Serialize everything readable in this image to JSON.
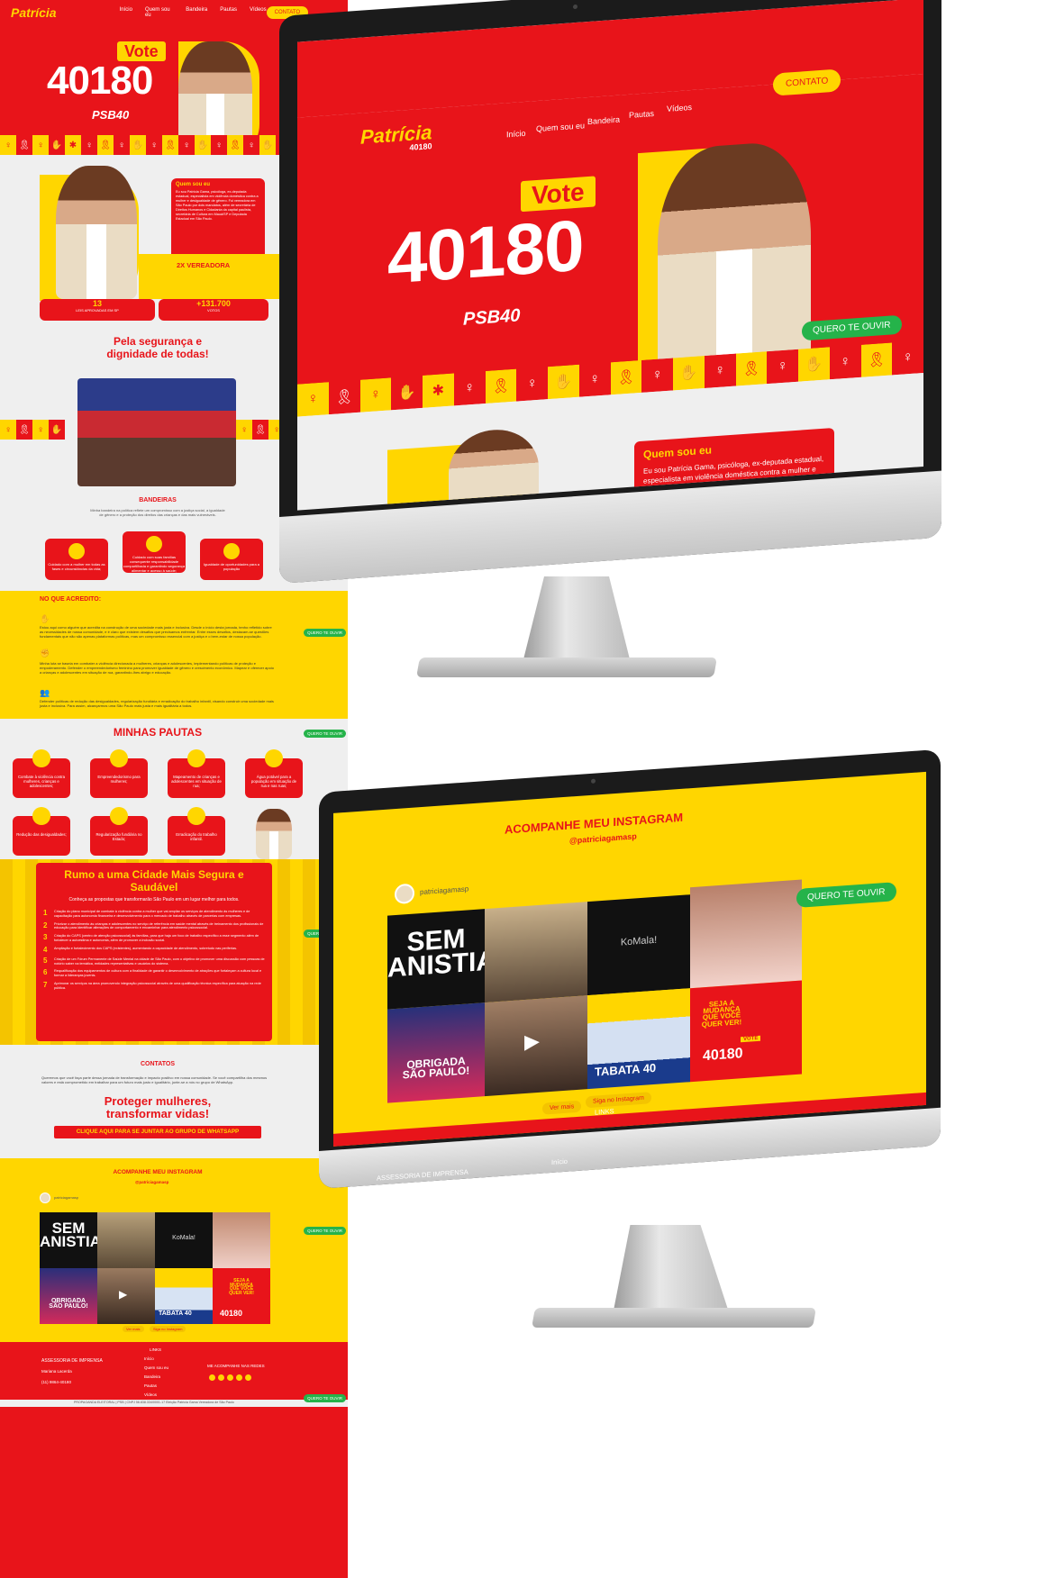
{
  "brand": {
    "first_name": "Patrícia",
    "last_name": "Gama",
    "number": "40180",
    "tag": "Vereadora",
    "party": "PSB40"
  },
  "nav": {
    "items": [
      "Início",
      "Quem sou eu",
      "Bandeira",
      "Pautas",
      "Vídeos"
    ],
    "contact": "CONTATO"
  },
  "hero": {
    "vote": "Vote",
    "number": "40180",
    "party": "PSB40",
    "whatsapp": "QUERO TE OUVIR"
  },
  "about": {
    "title": "Quem sou eu",
    "text": "Eu sou Patrícia Gama, psicóloga, ex-deputada estadual, especialista em violência doméstica contra a mulher e desigualdade de gênero. Fui vereadora em São Paulo por dois mandatos, além de secretária de",
    "short_text": "Eu sou Patrícia Gama, psicóloga, ex-deputada estadual, especialista em violência doméstica contra a mulher e desigualdade de gênero. Fui vereadora em São Paulo por dois mandatos, além de secretária de Direitos Humanos e Cidadania da capital paulista, secretária de Cultura em Mauá/SP e Deputada Estadual em São Paulo.",
    "badge": "2X VEREADORA",
    "stats": [
      {
        "value": "13",
        "label": "LEIS APROVADAS EM SP"
      },
      {
        "value": "+131.700",
        "label": "VOTOS"
      }
    ]
  },
  "safety": {
    "title_line1": "Pela segurança e",
    "title_line2": "dignidade de todas!"
  },
  "bandeiras": {
    "title": "BANDEIRAS",
    "intro": "Minha bandeira na política reflete um compromisso com a justiça social, a igualdade de gênero e a proteção dos direitos das crianças e das mais vulneráveis.",
    "cards": [
      "Cuidado com a mulher em todas as fases e circunstâncias da vida;",
      "Cuidado com suas famílias consequente responsabilidade compartilhada e garantindo segurança alimentar e acesso à saúde;",
      "Igualdade de oportunidades para a população"
    ]
  },
  "beliefs": {
    "title": "NO QUE ACREDITO:",
    "items": [
      "Estou aqui como alguém que acredita na construção de uma sociedade mais justa e inclusiva. Desde o início desta jornada, tenho refletido sobre as necessidades de nossa comunidade, e é claro que existem desafios que precisamos enfrentar. Entre esses desafios, destacam-se questões fundamentais que não são apenas plataformas políticas, mas um compromisso essencial com a justiça e o bem-estar de nossa população.",
      "Minha luta se baseia em combater a violência direcionada a mulheres, crianças e adolescentes, implementando políticas de proteção e empoderamento. Defender o empreendedorismo feminino para promover igualdade de gênero e crescimento econômico. Mapear e oferecer apoio a crianças e adolescentes em situação de rua, garantindo-lhes abrigo e educação.",
      "Defender políticas de redução das desigualdades, regularização fundiária e erradicação do trabalho infantil, visando construir uma sociedade mais justa e inclusiva. Para assim, alcançarmos uma São Paulo mais justa e mais igualitária a todos."
    ]
  },
  "pautas": {
    "title": "MINHAS PAUTAS",
    "items": [
      "Combate à violência contra mulheres, crianças e adolescentes;",
      "Empreendedorismo para mulheres;",
      "Mapeamento de crianças e adolescentes em situação de rua;",
      "Água potável para a população em situação de rua e nas ruas;",
      "Redução das desigualdades;",
      "Regularização fundiária no Estado;",
      "Erradicação do trabalho infantil."
    ]
  },
  "city": {
    "title_line1": "Rumo a uma Cidade Mais Segura e",
    "title_line2": "Saudável",
    "subtitle": "Conheça as propostas que transformarão São Paulo em um lugar melhor para todos.",
    "proposals": [
      "Criação do plano municipal de combate à violência contra a mulher que vai ampliar os serviços de atendimento às mulheres e de capacitação para autonomia financeira e desenvolvimento para o mercado de trabalho através de parcerias com empresas.",
      "Priorizar o atendimento às crianças e adolescentes no serviço de referência em saúde mental através de treinamento dos profissionais de educação para identificar alterações de comportamento e encaminhar para atendimento psicossocial.",
      "Criação do CAPS (centro de atenção psicossocial) às famílias, para que haja um foco de trabalho específico a esse segmento além de fortalecer a autoestima e autonomia, além de promover a inclusão social.",
      "Ampliação e fortalecimento dos CAPS (existentes), aumentando a capacidade de atendimento, sobretudo nas periferias.",
      "Criação de um Fórum Permanente de Saúde Mental na cidade de São Paulo, com o objetivo de promover uma discussão com pessoas de notório saber na temática, entidades representativas e usuários do sistema.",
      "Requalificação dos equipamentos de cultura com a finalidade de garantir o desenvolvimento de atrações que fortaleçam a cultura local e formar a lideranças juvenis.",
      "Aprimorar os serviços na área promovendo integração psicossocial através de uma qualificação técnica específica para atuação na rede pública."
    ]
  },
  "contacts": {
    "title": "CONTATOS",
    "text": "Queremos que você faça parte dessa jornada de transformação e impacto positivo em nossa comunidade. Se você compartilha dos mesmos valores e está comprometido em trabalhar para um futuro mais justo e igualitário, junte-se a nós no grupo de WhatsApp.",
    "slogan_line1": "Proteger mulheres,",
    "slogan_line2": "transformar vidas!",
    "cta": "CLIQUE AQUI PARA SE JUNTAR AO GRUPO DE WHATSAPP"
  },
  "instagram": {
    "title": "ACOMPANHE MEU INSTAGRAM",
    "handle": "@patriciagamasp",
    "account": "patriciagamasp",
    "tile1": "SEM ANISTIA",
    "tile3": "KoMala!",
    "tile5_line1": "OBRIGADA",
    "tile5_line2": "SÃO PAULO!",
    "tile7_name": "TABATA",
    "tile7_num": "40",
    "tile8_line1": "SEJA A",
    "tile8_line2": "MUDANÇA",
    "tile8_line3": "QUE VOCÊ",
    "tile8_line4": "QUER VER!",
    "tile8_vote": "VOTE",
    "tile8_num": "40180",
    "see_more": "Ver mais",
    "follow": "Siga no Instagram"
  },
  "footer": {
    "links_title": "LINKS",
    "press_title": "ASSESSORIA DE IMPRENSA",
    "press_name": "Mariana Lacerda",
    "press_phone": "(11) 9864-40180",
    "links": [
      "Início",
      "Quem sou eu",
      "Bandeira",
      "Pautas",
      "Vídeos"
    ],
    "social_title": "ME ACOMPANHE NAS REDES",
    "legal": "PROPAGANDA ELEITORAL | PSB | CNPJ 56.838.334/0001-17 Eleição Patricia Gama Vereadora de São Paulo"
  },
  "colors": {
    "red": "#e8141a",
    "yellow": "#ffd600",
    "green": "#25b34a"
  }
}
